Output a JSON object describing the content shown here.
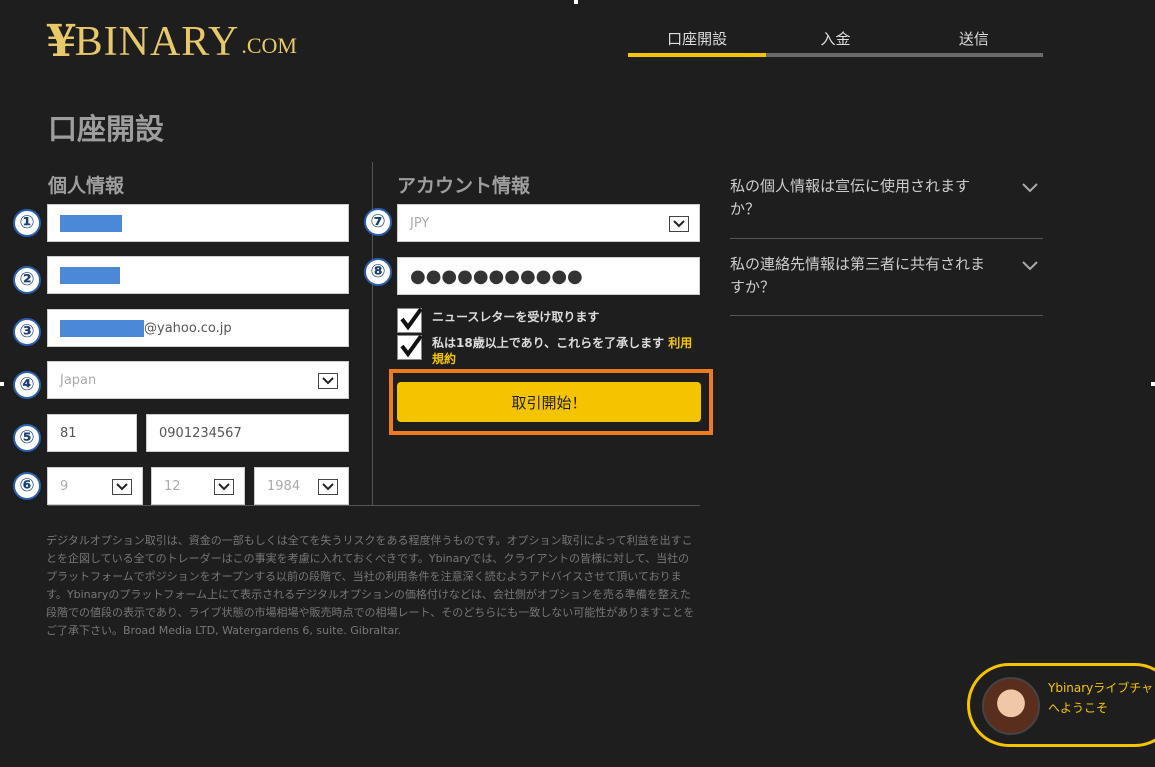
{
  "logo": {
    "yen": "¥",
    "word": "BINARY",
    "dotcom": ".COM"
  },
  "steps": [
    {
      "label": "口座開設",
      "active": true
    },
    {
      "label": "入金",
      "active": false
    },
    {
      "label": "送信",
      "active": false
    }
  ],
  "page_title": "口座開設",
  "personal": {
    "title": "個人情報",
    "numbers": [
      "①",
      "②",
      "③",
      "④",
      "⑤",
      "⑥"
    ],
    "email_suffix": "@yahoo.co.jp",
    "country": "Japan",
    "phone_code": "81",
    "phone": "0901234567",
    "birth_day": "9",
    "birth_month": "12",
    "birth_year": "1984"
  },
  "account": {
    "title": "アカウント情報",
    "numbers": [
      "⑦",
      "⑧"
    ],
    "currency": "JPY",
    "password": "●●●●●●●●●●●",
    "newsletter_label": "ニュースレターを受け取ります",
    "terms_label": "私は18歳以上であり、これらを了承します ",
    "terms_link": "利用規約",
    "cta_label": "取引開始！"
  },
  "faq": [
    {
      "question": "私の個人情報は宣伝に使用されますか？"
    },
    {
      "question": "私の連絡先情報は第三者に共有されますか？"
    }
  ],
  "disclaimer": "デジタルオプション取引は、資金の一部もしくは全てを失うリスクをある程度伴うものです。オプション取引によって利益を出すことを企図している全てのトレーダーはこの事実を考慮に入れておくべきです。Ybinaryでは、クライアントの皆様に対して、当社のプラットフォームでポジションをオープンする以前の段階で、当社の利用条件を注意深く読むようアドバイスさせて頂いております。Ybinaryのプラットフォーム上にて表示されるデジタルオプションの価格付けなどは、会社側がオプションを売る準備を整えた段階での値段の表示であり、ライブ状態の市場相場や販売時点での相場レート、そのどちらにも一致しない可能性がありますことをご了承下さい。Broad Media LTD, Watergardens 6, suite. Gibraltar.",
  "chat": {
    "line1": "Ybinaryライブチャット",
    "line2": "へようこそ"
  },
  "colors": {
    "accent": "#f5c400",
    "highlight_frame": "#f07a1e",
    "mask": "#4b88d6",
    "background": "#1e1e1e"
  }
}
